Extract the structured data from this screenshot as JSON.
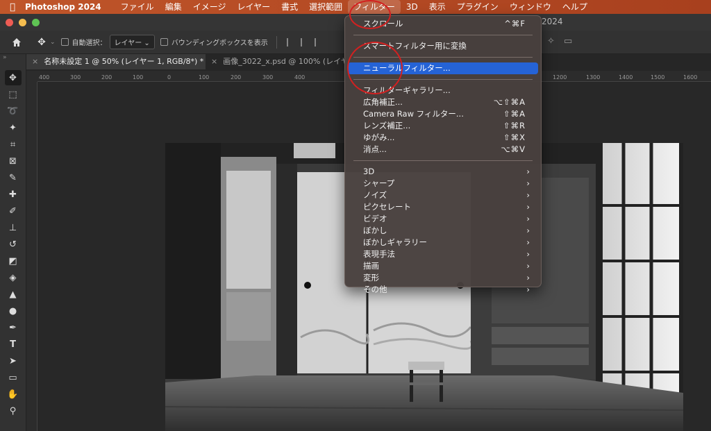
{
  "menubar": {
    "apple": "",
    "app_name": "Photoshop 2024",
    "items": [
      "ファイル",
      "編集",
      "イメージ",
      "レイヤー",
      "書式",
      "選択範囲",
      "フィルター",
      "3D",
      "表示",
      "プラグイン",
      "ウィンドウ",
      "ヘルプ"
    ]
  },
  "window": {
    "title": "2024"
  },
  "options": {
    "auto_select_label": "自動選択：",
    "layer_dropdown": "レイヤー",
    "bounding_box_label": "バウンディングボックスを表示"
  },
  "tabs": [
    {
      "close": "×",
      "label": "名称未設定 1 @ 50% (レイヤー 1, RGB/8*) *"
    },
    {
      "close": "×",
      "label": "画像_3022_x.psd @ 100% (レイヤー"
    }
  ],
  "ruler": {
    "ticks": [
      "400",
      "300",
      "200",
      "100",
      "0",
      "100",
      "200",
      "300",
      "400",
      "1200",
      "1300",
      "1400",
      "1500",
      "1600"
    ]
  },
  "filter_menu": {
    "top": [
      {
        "label": "スクロール",
        "shortcut": "^⌘F"
      }
    ],
    "group2": [
      {
        "label": "スマートフィルター用に変換"
      }
    ],
    "group3": [
      {
        "label": "ニューラルフィルター..."
      }
    ],
    "group4": [
      {
        "label": "フィルターギャラリー..."
      },
      {
        "label": "広角補正...",
        "shortcut": "⌥⇧⌘A"
      },
      {
        "label": "Camera Raw フィルター...",
        "shortcut": "⇧⌘A"
      },
      {
        "label": "レンズ補正...",
        "shortcut": "⇧⌘R"
      },
      {
        "label": "ゆがみ...",
        "shortcut": "⇧⌘X"
      },
      {
        "label": "消点...",
        "shortcut": "⌥⌘V"
      }
    ],
    "submenus": [
      "3D",
      "シャープ",
      "ノイズ",
      "ピクセレート",
      "ビデオ",
      "ぼかし",
      "ぼかしギャラリー",
      "表現手法",
      "描画",
      "変形",
      "その他"
    ],
    "arrow": "›"
  },
  "colors": {
    "menubar": "#b44a24",
    "highlight": "#2563d6",
    "annotation_circle": "#d32020"
  }
}
